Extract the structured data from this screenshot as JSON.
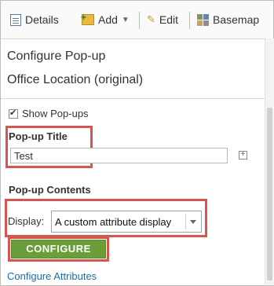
{
  "toolbar": {
    "details_label": "Details",
    "add_label": "Add",
    "edit_label": "Edit",
    "basemap_label": "Basemap"
  },
  "pane": {
    "title": "Configure Pop-up",
    "layer_name": "Office Location (original)"
  },
  "options": {
    "show_popups_label": "Show Pop-ups",
    "show_popups_checked": true
  },
  "popup_title": {
    "label": "Pop-up Title",
    "value": "Test"
  },
  "popup_contents": {
    "label": "Pop-up Contents",
    "display_label": "Display:",
    "display_value": "A custom attribute display",
    "configure_button": "CONFIGURE"
  },
  "configure_attributes_link": "Configure Attributes",
  "colors": {
    "highlight": "#d9534f",
    "configure_green": "#6a9e3a",
    "link_blue": "#1a6ea8"
  }
}
